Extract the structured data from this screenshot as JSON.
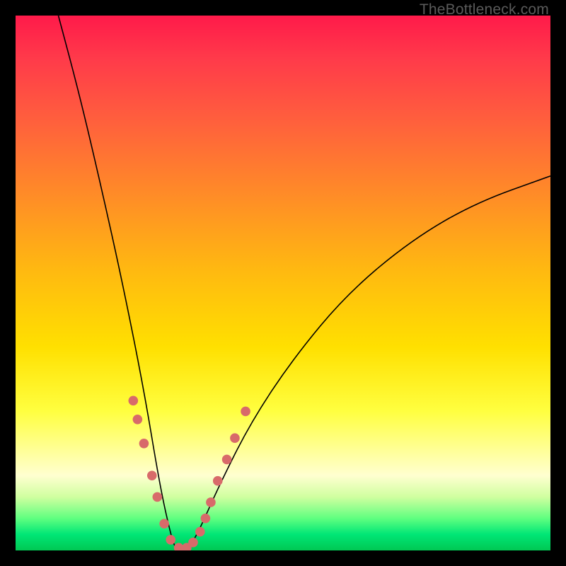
{
  "watermark": "TheBottleneck.com",
  "chart_data": {
    "type": "line",
    "title": "",
    "xlabel": "",
    "ylabel": "",
    "xlim": [
      0,
      100
    ],
    "ylim": [
      0,
      100
    ],
    "curve": {
      "type": "v-valley",
      "left_top": {
        "x": 8,
        "y": 100
      },
      "valley": {
        "x": 30,
        "y": 0
      },
      "right_top": {
        "x": 100,
        "y": 70
      },
      "description": "V-shaped curve descending steeply from top-left, reaching minimum near x=30 at y=0, then rising with decreasing slope toward upper-right",
      "points": [
        {
          "x": 8,
          "y": 100
        },
        {
          "x": 12,
          "y": 85
        },
        {
          "x": 16,
          "y": 68
        },
        {
          "x": 20,
          "y": 50
        },
        {
          "x": 24,
          "y": 30
        },
        {
          "x": 27,
          "y": 12
        },
        {
          "x": 29,
          "y": 3
        },
        {
          "x": 30,
          "y": 0
        },
        {
          "x": 32,
          "y": 0
        },
        {
          "x": 34,
          "y": 3
        },
        {
          "x": 38,
          "y": 12
        },
        {
          "x": 44,
          "y": 24
        },
        {
          "x": 52,
          "y": 36
        },
        {
          "x": 62,
          "y": 48
        },
        {
          "x": 74,
          "y": 58
        },
        {
          "x": 86,
          "y": 65
        },
        {
          "x": 100,
          "y": 70
        }
      ]
    },
    "markers": {
      "color": "#d86a6a",
      "radius_approx": 1.2,
      "clusters": [
        {
          "side": "left",
          "x_range": [
            22,
            29
          ],
          "y_range": [
            2,
            28
          ],
          "count_approx": 7
        },
        {
          "side": "right",
          "x_range": [
            34,
            44
          ],
          "y_range": [
            2,
            28
          ],
          "count_approx": 10
        }
      ],
      "points": [
        {
          "x": 22.0,
          "y": 28.0
        },
        {
          "x": 22.8,
          "y": 24.5
        },
        {
          "x": 24.0,
          "y": 20.0
        },
        {
          "x": 25.5,
          "y": 14.0
        },
        {
          "x": 26.5,
          "y": 10.0
        },
        {
          "x": 27.8,
          "y": 5.0
        },
        {
          "x": 29.0,
          "y": 2.0
        },
        {
          "x": 30.5,
          "y": 0.5
        },
        {
          "x": 32.0,
          "y": 0.5
        },
        {
          "x": 33.2,
          "y": 1.5
        },
        {
          "x": 34.5,
          "y": 3.5
        },
        {
          "x": 35.5,
          "y": 6.0
        },
        {
          "x": 36.5,
          "y": 9.0
        },
        {
          "x": 37.8,
          "y": 13.0
        },
        {
          "x": 39.5,
          "y": 17.0
        },
        {
          "x": 41.0,
          "y": 21.0
        },
        {
          "x": 43.0,
          "y": 26.0
        }
      ]
    }
  }
}
